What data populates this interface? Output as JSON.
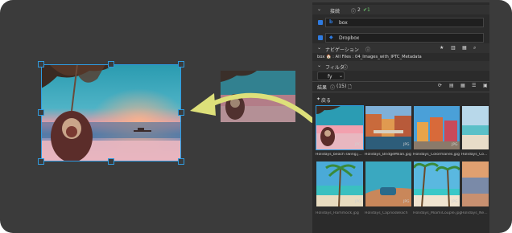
{
  "panel": {
    "section_connection": "接続",
    "conn_count": "2",
    "conn_ok": "✔1",
    "service1_name": "box",
    "service2_name": "Dropbox",
    "section_navigation": "ナビゲーション",
    "breadcrumb": "box  🏠 : All Files : 04_Images_with_IPTC_Metadata",
    "section_filter": "フィルタ",
    "filter_select": "fy",
    "results_label": "結果",
    "results_count": "(15)",
    "back_label": "戻る",
    "thumbnails": [
      {
        "caption": "Holidays_beach swing.j...",
        "badge": "JPG"
      },
      {
        "caption": "Holidays_BridgeMilan.jpg",
        "badge": "JPG"
      },
      {
        "caption": "Holidays_Colormanes.jpg",
        "badge": "JPG"
      },
      {
        "caption": "Holidays_Co...",
        "badge": ""
      },
      {
        "caption": "Holidays_Hammock.jpg",
        "badge": "JPG"
      },
      {
        "caption": "Holidays_CapriosBeach",
        "badge": "JPG"
      },
      {
        "caption": "Holidays_MiamiCouple.jpg",
        "badge": "JPG"
      },
      {
        "caption": "Holidays_Ne...",
        "badge": ""
      }
    ]
  },
  "colors": {
    "selection": "#2f9be0",
    "arrow": "#dde07a",
    "panel_bg": "#2b2b2b",
    "app_bg": "#3b3b3b"
  }
}
